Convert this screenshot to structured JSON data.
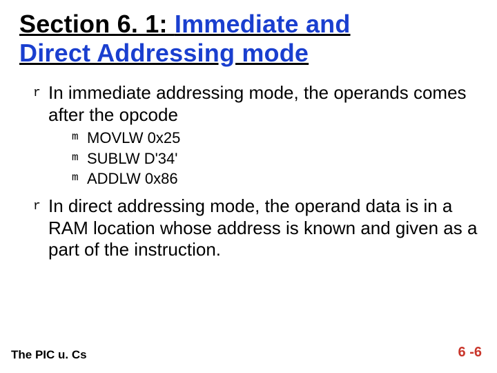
{
  "title": {
    "part1": "Section 6. 1: ",
    "part2_line1": "Immediate and",
    "part2_line2": "Direct Addressing mode"
  },
  "bullets": [
    {
      "marker": "r",
      "text": "In immediate addressing mode, the operands comes after the opcode",
      "sub": [
        {
          "marker": "m",
          "text": "MOVLW 0x25"
        },
        {
          "marker": "m",
          "text": "SUBLW D'34'"
        },
        {
          "marker": "m",
          "text": "ADDLW 0x86"
        }
      ]
    },
    {
      "marker": "r",
      "text": "In direct addressing mode, the operand data is in a RAM location whose address is known and given as a part of the instruction.",
      "sub": []
    }
  ],
  "footer": {
    "left": "The PIC u. Cs",
    "right": "6 -6"
  }
}
